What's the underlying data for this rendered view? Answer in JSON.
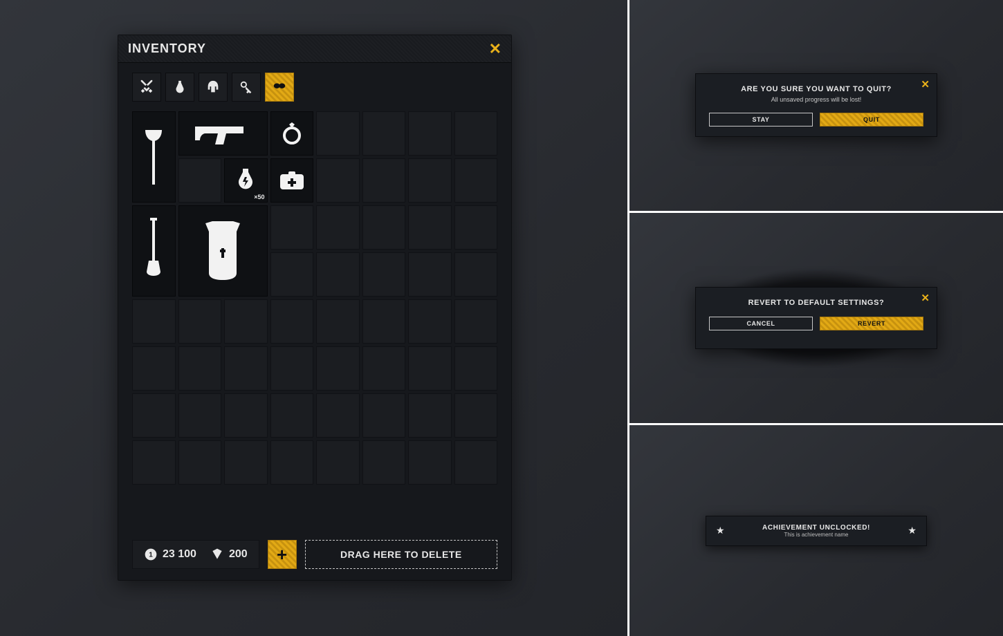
{
  "accent": "#e2a915",
  "inventory": {
    "title": "Inventory",
    "close": "✕",
    "tabs": [
      {
        "name": "weapons",
        "icon": "swords"
      },
      {
        "name": "consumables",
        "icon": "potion"
      },
      {
        "name": "armor",
        "icon": "helmet"
      },
      {
        "name": "keys",
        "icon": "key"
      },
      {
        "name": "misc",
        "icon": "mask",
        "selected": true
      }
    ],
    "grid": {
      "cols": 8,
      "rows": 8
    },
    "items": [
      {
        "id": "axe",
        "icon": "axe",
        "slot": "axe"
      },
      {
        "id": "gun",
        "icon": "handgun",
        "slot": "gun"
      },
      {
        "id": "ring",
        "icon": "ring",
        "slot": "ring"
      },
      {
        "id": "potion",
        "icon": "potion-lightning",
        "slot": "potion",
        "qty": "×50"
      },
      {
        "id": "medkit",
        "icon": "medkit",
        "slot": "medkit"
      },
      {
        "id": "shovel",
        "icon": "shovel",
        "slot": "shovel"
      },
      {
        "id": "vest",
        "icon": "vest",
        "slot": "vest"
      }
    ],
    "currency": {
      "coins": "23 100",
      "gems": "200"
    },
    "add": "+",
    "delete_hint": "Drag here to delete"
  },
  "dialogs": {
    "quit": {
      "title": "Are you sure you want to quit?",
      "subtitle": "All unsaved progress will be lost!",
      "cancel": "Stay",
      "confirm": "Quit"
    },
    "revert": {
      "title": "Revert to default settings?",
      "cancel": "Cancel",
      "confirm": "Revert"
    }
  },
  "toast": {
    "title": "Achievement Unclocked!",
    "subtitle": "This is achievement name"
  }
}
